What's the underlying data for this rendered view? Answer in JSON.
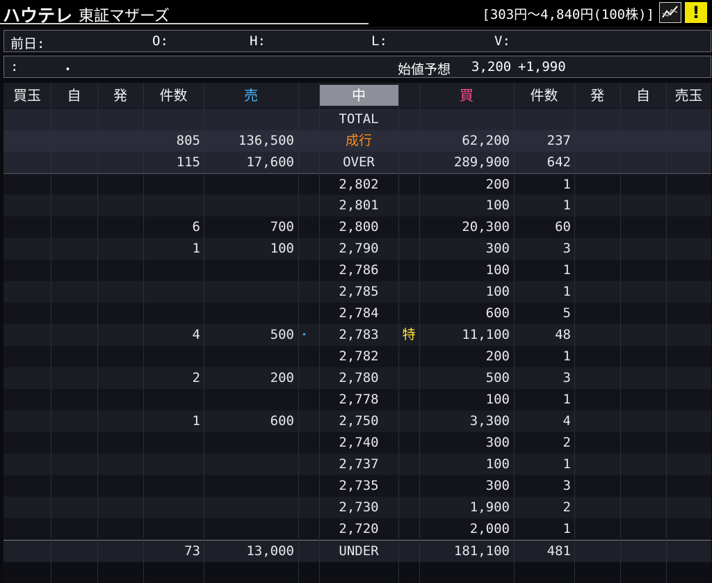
{
  "header": {
    "name": "ハウテレ",
    "market": "東証マザーズ",
    "price_range": "[303円～4,840円(100株)]",
    "alert_label": "!"
  },
  "info": {
    "prev_label": "前日:",
    "open_label": "O:",
    "high_label": "H:",
    "low_label": "L:",
    "volume_label": "V:",
    "row2_colon": ":",
    "row2_dot": "・",
    "opening_forecast_label": "始値予想",
    "opening_forecast_value": "3,200",
    "opening_forecast_change": "+1,990"
  },
  "columns": [
    "買玉",
    "自",
    "発",
    "件数",
    "売",
    "中",
    "買",
    "件数",
    "発",
    "自",
    "売玉"
  ],
  "colors": {
    "sell_header": "#49b8ff",
    "buy_header": "#ff4f8a",
    "market_order": "#ff8a18",
    "special": "#ffe53a",
    "change_positive": "#ff2f6d"
  },
  "rows": [
    {
      "sell_count": "",
      "sell_qty": "",
      "price": "TOTAL",
      "mark": "",
      "buy_qty": "",
      "buy_count": ""
    },
    {
      "sell_count": "805",
      "sell_qty": "136,500",
      "price": "成行",
      "mark": "",
      "buy_qty": "62,200",
      "buy_count": "237"
    },
    {
      "sell_count": "115",
      "sell_qty": "17,600",
      "price": "OVER",
      "mark": "",
      "buy_qty": "289,900",
      "buy_count": "642"
    },
    {
      "sell_count": "",
      "sell_qty": "",
      "price": "2,802",
      "mark": "",
      "buy_qty": "200",
      "buy_count": "1"
    },
    {
      "sell_count": "",
      "sell_qty": "",
      "price": "2,801",
      "mark": "",
      "buy_qty": "100",
      "buy_count": "1"
    },
    {
      "sell_count": "6",
      "sell_qty": "700",
      "price": "2,800",
      "mark": "",
      "buy_qty": "20,300",
      "buy_count": "60"
    },
    {
      "sell_count": "1",
      "sell_qty": "100",
      "price": "2,790",
      "mark": "",
      "buy_qty": "300",
      "buy_count": "3"
    },
    {
      "sell_count": "",
      "sell_qty": "",
      "price": "2,786",
      "mark": "",
      "buy_qty": "100",
      "buy_count": "1"
    },
    {
      "sell_count": "",
      "sell_qty": "",
      "price": "2,785",
      "mark": "",
      "buy_qty": "100",
      "buy_count": "1"
    },
    {
      "sell_count": "",
      "sell_qty": "",
      "price": "2,784",
      "mark": "",
      "buy_qty": "600",
      "buy_count": "5"
    },
    {
      "sell_count": "4",
      "sell_qty": "500",
      "price": "2,783",
      "mark": "特",
      "buy_qty": "11,100",
      "buy_count": "48"
    },
    {
      "sell_count": "",
      "sell_qty": "",
      "price": "2,782",
      "mark": "",
      "buy_qty": "200",
      "buy_count": "1"
    },
    {
      "sell_count": "2",
      "sell_qty": "200",
      "price": "2,780",
      "mark": "",
      "buy_qty": "500",
      "buy_count": "3"
    },
    {
      "sell_count": "",
      "sell_qty": "",
      "price": "2,778",
      "mark": "",
      "buy_qty": "100",
      "buy_count": "1"
    },
    {
      "sell_count": "1",
      "sell_qty": "600",
      "price": "2,750",
      "mark": "",
      "buy_qty": "3,300",
      "buy_count": "4"
    },
    {
      "sell_count": "",
      "sell_qty": "",
      "price": "2,740",
      "mark": "",
      "buy_qty": "300",
      "buy_count": "2"
    },
    {
      "sell_count": "",
      "sell_qty": "",
      "price": "2,737",
      "mark": "",
      "buy_qty": "100",
      "buy_count": "1"
    },
    {
      "sell_count": "",
      "sell_qty": "",
      "price": "2,735",
      "mark": "",
      "buy_qty": "300",
      "buy_count": "3"
    },
    {
      "sell_count": "",
      "sell_qty": "",
      "price": "2,730",
      "mark": "",
      "buy_qty": "1,900",
      "buy_count": "2"
    },
    {
      "sell_count": "",
      "sell_qty": "",
      "price": "2,720",
      "mark": "",
      "buy_qty": "2,000",
      "buy_count": "1"
    },
    {
      "sell_count": "73",
      "sell_qty": "13,000",
      "price": "UNDER",
      "mark": "",
      "buy_qty": "181,100",
      "buy_count": "481"
    }
  ]
}
